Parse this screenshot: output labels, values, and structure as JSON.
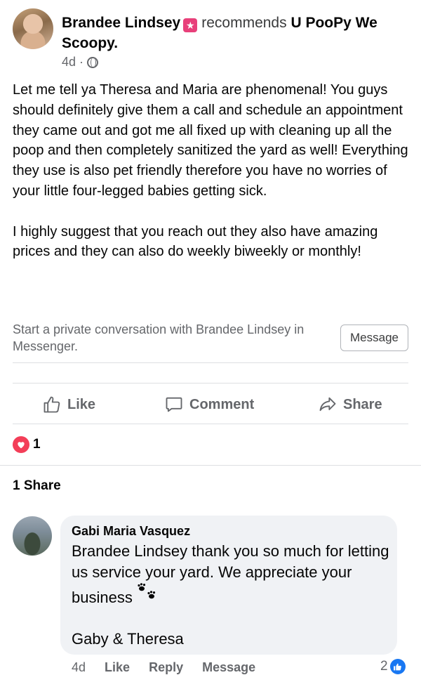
{
  "post": {
    "author": "Brandee Lindsey",
    "badge_icon": "star-icon",
    "recommends_label": "recommends",
    "page_name": "U PooPy We Scoopy",
    "page_suffix": ".",
    "age": "4d",
    "dot": "·",
    "privacy_icon": "globe-icon",
    "paragraph_1": "Let me tell ya Theresa and Maria are phenomenal! You guys should definitely give them a call and schedule an appointment they came out and got me all fixed up with cleaning up all the poop and then completely sanitized the yard as well! Everything they use is also pet friendly therefore you have no worries of your little four-legged babies getting sick.",
    "paragraph_2": "I highly suggest that you reach out they also have amazing prices and they can also do weekly biweekly or monthly!"
  },
  "messenger": {
    "prompt": "Start a private conversation with Brandee Lindsey in Messenger.",
    "button_label": "Message"
  },
  "actions": {
    "like": "Like",
    "comment": "Comment",
    "share": "Share"
  },
  "reactions": {
    "icon": "heart-icon",
    "count": "1",
    "color": "#f33e58"
  },
  "shares": {
    "label": "1 Share"
  },
  "comment": {
    "author": "Gabi Maria Vasquez",
    "text": "Brandee Lindsey  thank you so much for letting us service your yard. We appreciate your business",
    "emoji_icon": "paw-prints-icon",
    "signoff": "Gaby & Theresa",
    "age": "4d",
    "like_label": "Like",
    "reply_label": "Reply",
    "message_label": "Message",
    "like_count": "2",
    "like_badge_color": "#1877f2"
  }
}
